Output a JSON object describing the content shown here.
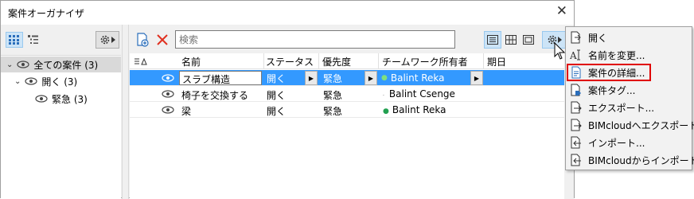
{
  "window": {
    "title": "案件オーガナイザ"
  },
  "search": {
    "placeholder": "検索"
  },
  "tree": {
    "items": [
      {
        "label": "全ての案件 (3)",
        "level": 0,
        "expanded": true,
        "selected": true
      },
      {
        "label": "開く (3)",
        "level": 1,
        "expanded": true,
        "selected": false
      },
      {
        "label": "緊急 (3)",
        "level": 2,
        "expanded": false,
        "selected": false
      }
    ]
  },
  "table": {
    "columns": [
      "名前",
      "ステータス",
      "優先度",
      "チームワーク所有者",
      "期日"
    ],
    "rows": [
      {
        "name": "スラブ構造",
        "status": "開く",
        "priority": "緊急",
        "owner": "Balint Reka",
        "due": "",
        "selected": true,
        "owner_dot": true
      },
      {
        "name": "椅子を交換する",
        "status": "開く",
        "priority": "緊急",
        "owner": "Balint Csenge",
        "due": "",
        "selected": false,
        "owner_dot": false
      },
      {
        "name": "梁",
        "status": "開く",
        "priority": "緊急",
        "owner": "Balint Reka",
        "due": "",
        "selected": false,
        "owner_dot": true
      }
    ]
  },
  "menu": {
    "items": [
      {
        "label": "開く",
        "icon": "open-icon"
      },
      {
        "label": "名前を変更...",
        "icon": "rename-icon"
      },
      {
        "label": "案件の詳細...",
        "icon": "details-icon",
        "highlighted": true
      },
      {
        "label": "案件タグ...",
        "icon": "tag-icon"
      },
      {
        "label": "エクスポート...",
        "icon": "export-icon"
      },
      {
        "label": "BIMcloudへエクスポート...",
        "icon": "cloud-export-icon"
      },
      {
        "label": "インポート...",
        "icon": "import-icon"
      },
      {
        "label": "BIMcloudからインポート...",
        "icon": "cloud-import-icon"
      }
    ]
  },
  "colors": {
    "selection": "#3399ff",
    "highlight_frame": "#e00000",
    "owner_dot": "#22a050",
    "delete": "#e03020",
    "icon_blue": "#2a6ebb"
  }
}
